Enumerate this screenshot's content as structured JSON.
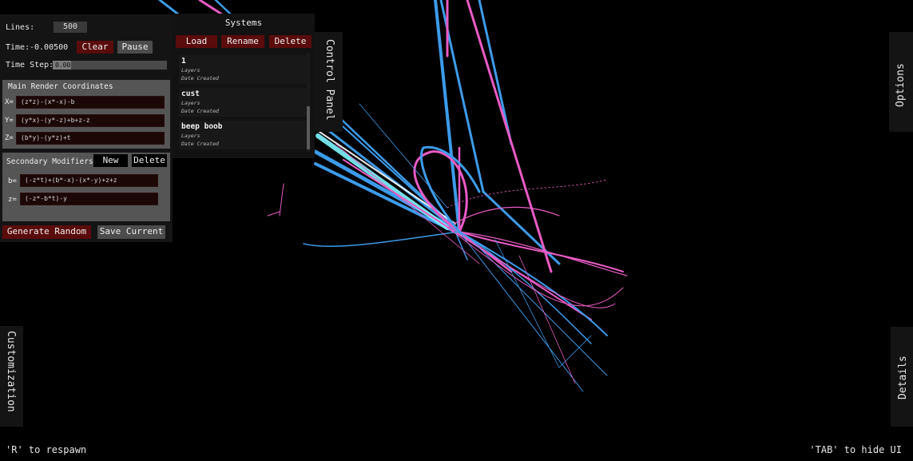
{
  "control": {
    "lines_label": "Lines:",
    "lines_value": "500",
    "time_label": "Time:",
    "time_value": "-0.00500",
    "clear_label": "Clear",
    "pause_label": "Pause",
    "timestep_label": "Time Step:",
    "timestep_value": "0.00",
    "timestep_fill": 0.16
  },
  "main_coords": {
    "title": "Main Render Coordinates",
    "x_label": "X=",
    "x_value": "(z*z)-(x*-x)-b",
    "y_label": "Y=",
    "y_value": "(y*x)-(y*-z)+b+z-z",
    "z_label": "Z=",
    "z_value": "(b*y)-(y*z)+t"
  },
  "secondary": {
    "title": "Secondary Modifiers",
    "new_label": "New",
    "delete_label": "Delete",
    "b_label": "b=",
    "b_value": "(-z*t)+(b*-x)-(x*-y)+z+z",
    "z_label": "z=",
    "z_value": "(-z*-b*t)-y"
  },
  "footer_buttons": {
    "generate_label": "Generate Random",
    "save_label": "Save Current"
  },
  "systems": {
    "title": "Systems",
    "load_label": "Load",
    "rename_label": "Rename",
    "delete_label": "Delete",
    "items": [
      {
        "name": "1",
        "layers": "Layers",
        "date": "Date Created"
      },
      {
        "name": "cust",
        "layers": "Layers",
        "date": "Date Created"
      },
      {
        "name": "beep boob",
        "layers": "Layers",
        "date": "Date Created"
      }
    ]
  },
  "tabs": {
    "control_panel": "Control Panel",
    "options": "Options",
    "customization": "Customization",
    "details": "Details"
  },
  "hints": {
    "respawn": "'R' to respawn",
    "hide_ui": "'TAB' to hide UI"
  },
  "colors": {
    "accent_red": "#5a0b0b",
    "line_blue": "#3d9be9",
    "line_pink": "#e95bc4",
    "line_cyan": "#7ff6ff"
  }
}
